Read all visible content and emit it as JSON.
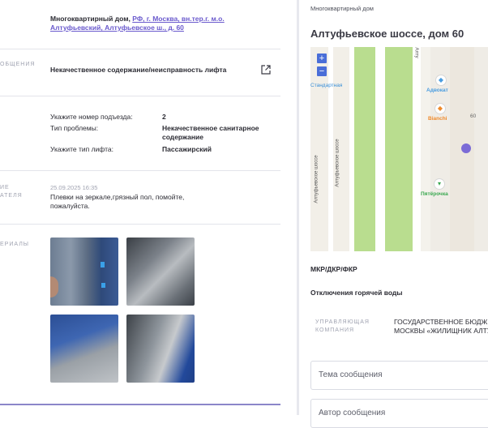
{
  "left": {
    "building": {
      "type": "Многоквартирный дом,",
      "address": "РФ, г. Москва, вн.тер.г. м.о. Алтуфьевский, Алтуфьевское ш., д. 60"
    },
    "topic_label": "ОБЩЕНИЯ",
    "topic_value": "Некачественное содержание/неисправность лифта",
    "details": [
      {
        "label": "Укажите номер подъезда:",
        "value": "2"
      },
      {
        "label": "Тип проблемы:",
        "value": "Некачественное санитарное содержание"
      },
      {
        "label": "Укажите тип лифта:",
        "value": "Пассажирский"
      }
    ],
    "comment_label_1": "ИЕ",
    "comment_label_2": "АТЕЛЯ",
    "comment_date": "25.09.2025 16:35",
    "comment_text": "Плевки на зеркале,грязный пол, помойте, пожалуйста.",
    "materials_label": "ЕРИАЛЫ"
  },
  "right": {
    "subtitle": "Многоквартирный дом",
    "title": "Алтуфьевское шоссе, дом 60",
    "map": {
      "zoom_in": "+",
      "zoom_out": "−",
      "label_standard": "Стандартная",
      "label_advokat": "Адвокат",
      "label_bianchi": "Bianchi",
      "label_number": "60",
      "label_pyaterochka": "Пятёрочка",
      "street_1": "Алтуфьевское шоссе",
      "street_2": "Алтуфьевское шоссе",
      "street_3": "Алту"
    },
    "mkr": "МКР/ДКР/ФКР",
    "hot_water": "Отключения горячей воды",
    "mgmt_label_1": "УПРАВЛЯЮЩАЯ",
    "mgmt_label_2": "КОМПАНИЯ",
    "mgmt_value_1": "ГОСУДАРСТВЕННОЕ БЮДЖЕ",
    "mgmt_value_2": "МОСКВЫ «ЖИЛИЩНИК АЛТУ",
    "subject_placeholder": "Тема сообщения",
    "author_placeholder": "Автор сообщения"
  },
  "colors": {
    "accent": "#6a5acd",
    "map_green": "#b9dd8f",
    "map_pin": "#7b6bd6"
  }
}
